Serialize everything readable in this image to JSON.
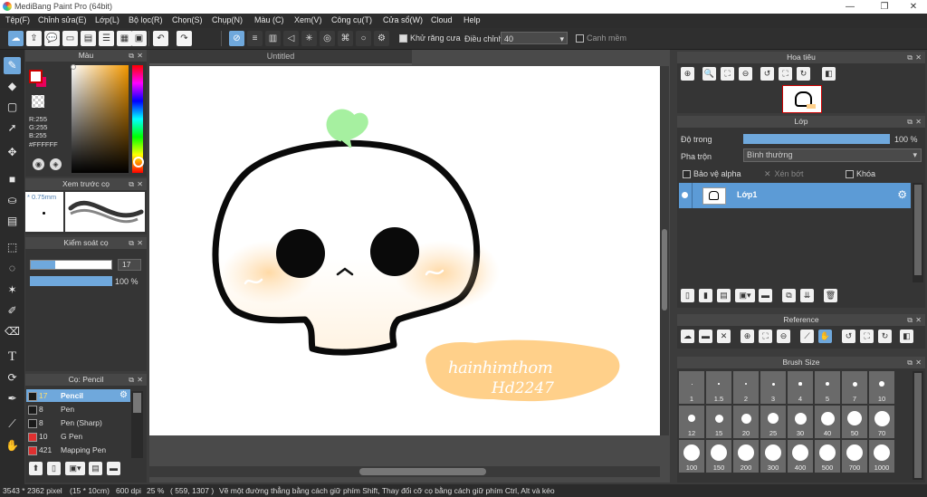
{
  "window": {
    "title": "MediBang Paint Pro (64bit)"
  },
  "menu": [
    "Tệp(F)",
    "Chỉnh sửa(E)",
    "Lớp(L)",
    "Bộ lọc(R)",
    "Chọn(S)",
    "Chụp(N)",
    "Màu (C)",
    "Xem(V)",
    "Công cụ(T)",
    "Cửa sổ(W)",
    "Cloud",
    "Help"
  ],
  "toolbar": {
    "antialias_label": "Khử răng cưa",
    "correction_label": "Điều chỉnh",
    "correction_value": "40",
    "smooth_label": "Canh mềm"
  },
  "color_panel": {
    "title": "Màu",
    "r": "R:255",
    "g": "G:255",
    "b": "B:255",
    "hex": "#FFFFFF"
  },
  "brush_preview": {
    "title": "Xem trước cọ",
    "size": "0.75mm"
  },
  "brush_control": {
    "title": "Kiểm soát cọ",
    "size_value": "17",
    "size_fraction": 0.3,
    "opacity_value": "100 %",
    "opacity_fraction": 1.0
  },
  "brush_list": {
    "title": "Cọ: Pencil",
    "items": [
      {
        "size": "17",
        "name": "Pencil",
        "color": "#1a1a1a",
        "selected": true
      },
      {
        "size": "8",
        "name": "Pen",
        "color": "#1a1a1a"
      },
      {
        "size": "8",
        "name": "Pen (Sharp)",
        "color": "#1a1a1a"
      },
      {
        "size": "10",
        "name": "G Pen",
        "color": "#e03030"
      },
      {
        "size": "421",
        "name": "Mapping Pen",
        "color": "#e03030"
      }
    ]
  },
  "canvas": {
    "tab_title": "Untitled",
    "signature": "hainhimthom",
    "signature_sub": "Hd2247"
  },
  "navigator": {
    "title": "Hoa tiêu"
  },
  "layer_panel": {
    "title": "Lớp",
    "opacity_label": "Độ trong",
    "opacity_value": "100 %",
    "opacity_fraction": 1.0,
    "blend_label": "Pha trộn",
    "blend_value": "Bình thường",
    "protect_alpha": "Bảo vệ alpha",
    "clipping": "Xén bớt",
    "lock": "Khóa",
    "layer_name": "Lớp1"
  },
  "reference": {
    "title": "Reference"
  },
  "brush_size": {
    "title": "Brush Size",
    "sizes": [
      "1",
      "1.5",
      "2",
      "3",
      "4",
      "5",
      "7",
      "10",
      "12",
      "15",
      "20",
      "25",
      "30",
      "40",
      "50",
      "70",
      "100",
      "150",
      "200",
      "300",
      "400",
      "500",
      "700",
      "1000"
    ]
  },
  "status": {
    "dims": "3543 * 2362 pixel",
    "cm": "(15 * 10cm)",
    "dpi": "600 dpi",
    "zoom": "25 %",
    "coords": "( 559, 1307 )",
    "hint": "Vẽ một đường thẳng bằng cách giữ phím Shift, Thay đổi cỡ cọ bằng cách giữ phím Ctrl, Alt và kéo"
  },
  "colors": {
    "accent": "#6fa8dc",
    "panel": "#353535",
    "blush": "#ffd08a",
    "sprout": "#a6f0a0",
    "note_bg": "#ffd08a"
  }
}
